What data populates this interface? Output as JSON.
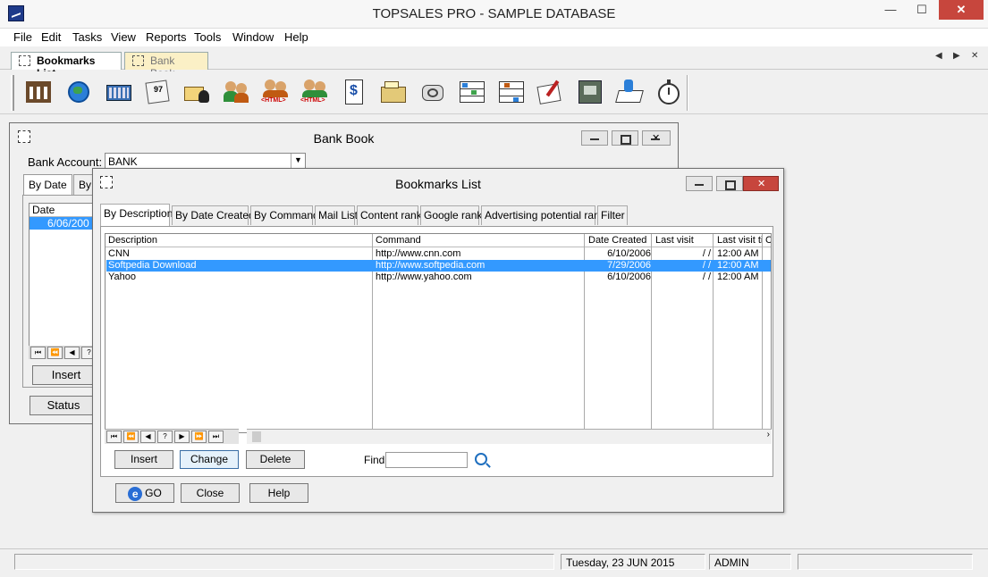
{
  "window": {
    "title": "TOPSALES PRO - SAMPLE DATABASE"
  },
  "menu": [
    "File",
    "Edit",
    "Tasks",
    "View",
    "Reports",
    "Tools",
    "Window",
    "Help"
  ],
  "doc_tabs": [
    {
      "label": "Bookmarks List",
      "active": true
    },
    {
      "label": "Bank Book",
      "active": false
    }
  ],
  "toolbar_icons": [
    "bank-icon",
    "internet-icon",
    "calculator-icon",
    "calendar-icon",
    "contacts-icon",
    "users-icon",
    "users-html-icon",
    "users-html-2-icon",
    "invoice-icon",
    "cash-register-icon",
    "phone-icon",
    "warehouse-icon",
    "warehouse-2-icon",
    "write-icon",
    "safe-icon",
    "notes-icon",
    "timer-icon"
  ],
  "bankbook": {
    "title": "Bank Book",
    "account_label": "Bank Account:",
    "account_value": "BANK",
    "tabs": [
      "By Date",
      "By"
    ],
    "grid_header": "Date",
    "grid_row": "6/06/200",
    "insert": "Insert",
    "status": "Status"
  },
  "bookmarks": {
    "title": "Bookmarks List",
    "tabs": [
      "By Description",
      "By Date Created",
      "By Command",
      "Mail List",
      "Content rank",
      "Google rank",
      "Advertising potential rank",
      "Filter"
    ],
    "columns": [
      "Description",
      "Command",
      "Date Created",
      "Last visit",
      "Last visit ti",
      "C"
    ],
    "rows": [
      {
        "description": "CNN",
        "command": "http://www.cnn.com",
        "date_created": "6/10/2006",
        "last_visit": "/  /",
        "last_visit_time": "12:00 AM",
        "selected": false
      },
      {
        "description": "Softpedia Download",
        "command": "http://www.softpedia.com",
        "date_created": "7/29/2006",
        "last_visit": "/  /",
        "last_visit_time": "12:00 AM",
        "selected": true
      },
      {
        "description": "Yahoo",
        "command": "http://www.yahoo.com",
        "date_created": "6/10/2006",
        "last_visit": "/  /",
        "last_visit_time": "12:00 AM",
        "selected": false
      }
    ],
    "nav": [
      "⏮",
      "⏪",
      "◀",
      "?",
      "▶",
      "⏩",
      "⏭"
    ],
    "insert": "Insert",
    "change": "Change",
    "delete": "Delete",
    "find_label": "Find:",
    "find_value": "",
    "go": "GO",
    "close": "Close",
    "help": "Help"
  },
  "status": {
    "date": "Tuesday, 23 JUN 2015",
    "user": "ADMIN"
  },
  "colors": {
    "selection": "#3399ff",
    "close_button": "#c7463d",
    "inactive_tab": "#fbf0c6"
  }
}
